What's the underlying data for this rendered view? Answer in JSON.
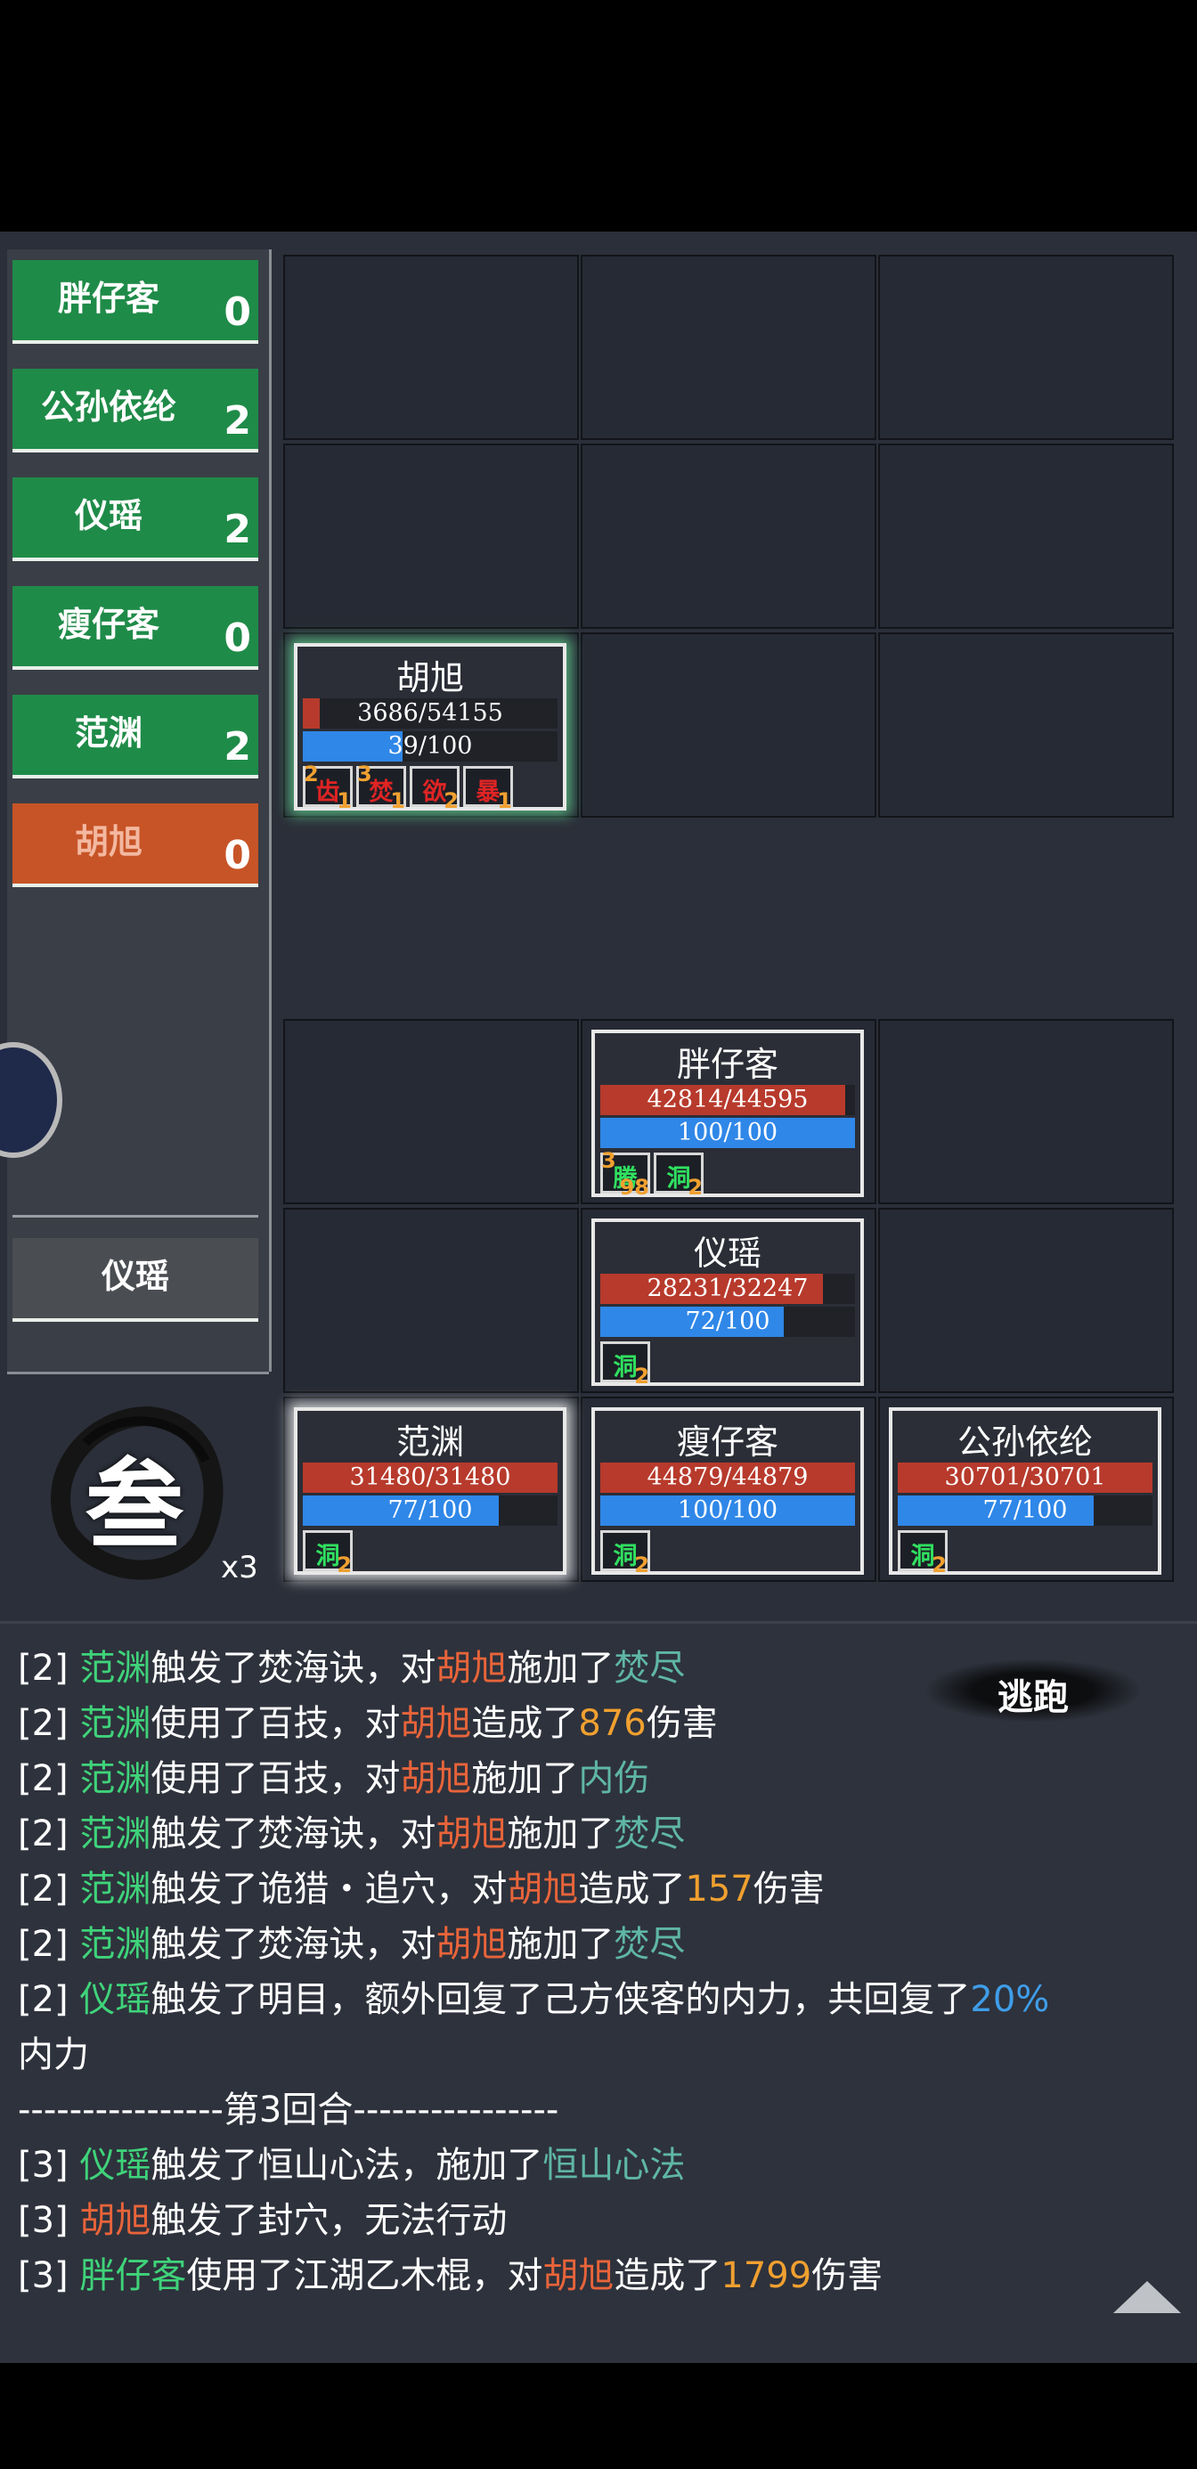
{
  "sidebar": {
    "items": [
      {
        "name": "胖仔客",
        "count": "0"
      },
      {
        "name": "公孙依纶",
        "count": "2"
      },
      {
        "name": "仪瑶",
        "count": "2"
      },
      {
        "name": "瘦仔客",
        "count": "0"
      },
      {
        "name": "范渊",
        "count": "2"
      },
      {
        "name": "胡旭",
        "count": "0"
      }
    ],
    "current": "仪瑶"
  },
  "skill": {
    "glyph": "叁",
    "multiplier": "x3"
  },
  "enemy": {
    "name": "胡旭",
    "hp": "3686/54155",
    "hp_pct": 6.8,
    "mp": "39/100",
    "mp_pct": 39,
    "buffs": [
      {
        "glyph": "齿",
        "tl": "2",
        "br": "1"
      },
      {
        "glyph": "焚",
        "tl": "3",
        "br": "1"
      },
      {
        "glyph": "欲",
        "tl": "",
        "br": "2"
      },
      {
        "glyph": "暴",
        "tl": "",
        "br": "1"
      }
    ]
  },
  "allies": [
    {
      "name": "胖仔客",
      "hp": "42814/44595",
      "hp_pct": 96,
      "mp": "100/100",
      "mp_pct": 100,
      "buffs": [
        {
          "glyph": "腾",
          "tl": "3",
          "br": "98"
        },
        {
          "glyph": "洞",
          "tl": "",
          "br": "2"
        }
      ]
    },
    {
      "name": "仪瑶",
      "hp": "28231/32247",
      "hp_pct": 87.5,
      "mp": "72/100",
      "mp_pct": 72,
      "buffs": [
        {
          "glyph": "洞",
          "tl": "",
          "br": "2"
        }
      ]
    },
    {
      "name": "范渊",
      "hp": "31480/31480",
      "hp_pct": 100,
      "mp": "77/100",
      "mp_pct": 77,
      "buffs": [
        {
          "glyph": "洞",
          "tl": "",
          "br": "2"
        }
      ]
    },
    {
      "name": "瘦仔客",
      "hp": "44879/44879",
      "hp_pct": 100,
      "mp": "100/100",
      "mp_pct": 100,
      "buffs": [
        {
          "glyph": "洞",
          "tl": "",
          "br": "2"
        }
      ]
    },
    {
      "name": "公孙依纶",
      "hp": "30701/30701",
      "hp_pct": 100,
      "mp": "77/100",
      "mp_pct": 77,
      "buffs": [
        {
          "glyph": "洞",
          "tl": "",
          "br": "2"
        }
      ]
    }
  ],
  "escape_label": "逃跑",
  "log": [
    [
      "[2] ",
      "w",
      "范渊",
      "g",
      "触发了焚海诀，对",
      "w",
      "胡旭",
      "o",
      "施加了",
      "w",
      "焚尽",
      "t"
    ],
    [
      "[2] ",
      "w",
      "范渊",
      "g",
      "使用了百技，对",
      "w",
      "胡旭",
      "o",
      "造成了",
      "w",
      "876",
      "y",
      "伤害",
      "w"
    ],
    [
      "[2] ",
      "w",
      "范渊",
      "g",
      "使用了百技，对",
      "w",
      "胡旭",
      "o",
      "施加了",
      "w",
      "内伤",
      "t"
    ],
    [
      "[2] ",
      "w",
      "范渊",
      "g",
      "触发了焚海诀，对",
      "w",
      "胡旭",
      "o",
      "施加了",
      "w",
      "焚尽",
      "t"
    ],
    [
      "[2] ",
      "w",
      "范渊",
      "g",
      "触发了诡猎・追穴，对",
      "w",
      "胡旭",
      "o",
      "造成了",
      "w",
      "157",
      "y",
      "伤害",
      "w"
    ],
    [
      "[2] ",
      "w",
      "范渊",
      "g",
      "触发了焚海诀，对",
      "w",
      "胡旭",
      "o",
      "施加了",
      "w",
      "焚尽",
      "t"
    ],
    [
      "[2] ",
      "w",
      "仪瑶",
      "g",
      "触发了明目，额外回复了己方侠客的内力，共回复了",
      "w",
      "20%",
      "b"
    ],
    [
      "内力",
      "w"
    ],
    [
      "----------------第3回合----------------",
      "w"
    ],
    [
      "[3] ",
      "w",
      "仪瑶",
      "g",
      "触发了恒山心法，施加了",
      "w",
      "恒山心法",
      "t"
    ],
    [
      "[3] ",
      "w",
      "胡旭",
      "o",
      "触发了封穴，无法行动",
      "w"
    ],
    [
      "[3] ",
      "w",
      "胖仔客",
      "g",
      "使用了江湖乙木棍，对",
      "w",
      "胡旭",
      "o",
      "造成了",
      "w",
      "1799",
      "y",
      "伤害",
      "w"
    ]
  ]
}
